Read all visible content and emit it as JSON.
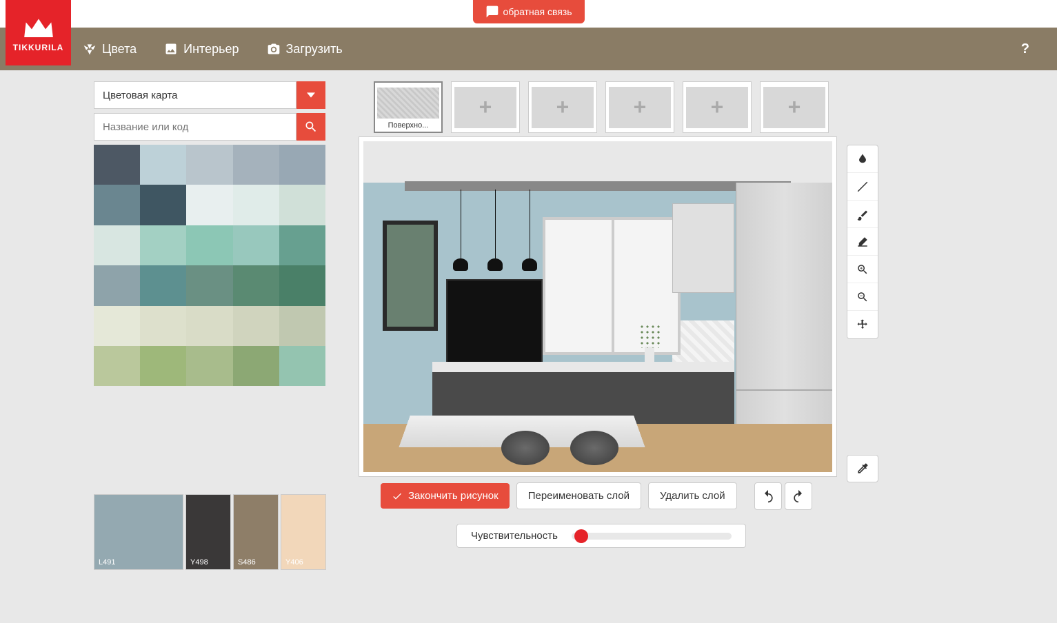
{
  "feedback": {
    "label": "обратная связь"
  },
  "brand": "TIKKURILA",
  "nav": {
    "colors": "Цвета",
    "interior": "Интерьер",
    "upload": "Загрузить",
    "help": "?"
  },
  "dropdown": {
    "label": "Цветовая карта"
  },
  "search": {
    "placeholder": "Название или код"
  },
  "palette": [
    "#4d5864",
    "#bdd1d8",
    "#b9c5cc",
    "#a5b2bc",
    "#98a8b4",
    "#6a8690",
    "#3f5662",
    "#e8efef",
    "#e0ece9",
    "#d0e0d8",
    "#d8e6e1",
    "#a3d0c3",
    "#8cc7b5",
    "#98c8bd",
    "#67a090",
    "#8ea3aa",
    "#5d9090",
    "#6a9083",
    "#5a8a72",
    "#4a8068",
    "#e5e8d8",
    "#dde0cc",
    "#d9dcc7",
    "#d0d4be",
    "#c0c8b0",
    "#bac89c",
    "#9eb87a",
    "#a8bc8c",
    "#8ca874",
    "#94c4b0"
  ],
  "selected": [
    {
      "label": "L491",
      "color": "#94a9b1"
    },
    {
      "label": "Y498",
      "color": "#3a3838"
    },
    {
      "label": "S486",
      "color": "#8e7e68"
    },
    {
      "label": "Y406",
      "color": "#f2d7ba"
    }
  ],
  "thumbs": {
    "active_label": "Поверхно..."
  },
  "actions": {
    "finish": "Закончить рисунок",
    "rename": "Переименовать слой",
    "delete": "Удалить слой"
  },
  "sensitivity": {
    "label": "Чувствительность"
  }
}
